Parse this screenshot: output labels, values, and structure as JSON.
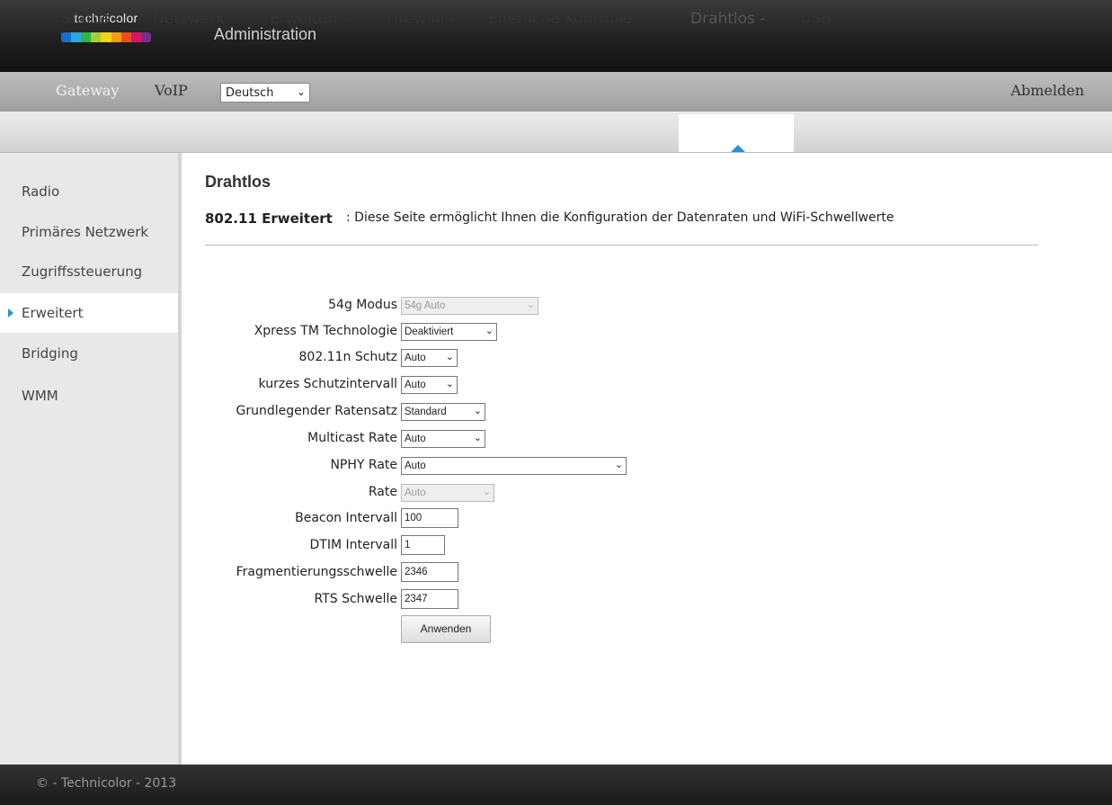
{
  "header": {
    "logo_text": "technicolor",
    "title": "Administration",
    "logo_colors": [
      "#1a6fc9",
      "#2aa7e1",
      "#32b34a",
      "#a6ce39",
      "#f7d117",
      "#f39c12",
      "#e94e1b",
      "#d6186b",
      "#7b2d8e"
    ]
  },
  "subnav": {
    "gateway": "Gateway",
    "voip": "VoIP",
    "language": "Deutsch",
    "logout": "Abmelden"
  },
  "nav": {
    "items": [
      "Status -",
      "Netzwerk -",
      "Erweitert -",
      "Firewall -",
      "Elterliche Kontrolle -",
      "Drahtlos -",
      "USB"
    ],
    "active_index": 5,
    "accent": "#2a8fd9"
  },
  "sidebar": {
    "items": [
      "Radio",
      "Primäres Netzwerk",
      "Zugriffssteuerung",
      "Erweitert",
      "Bridging",
      "WMM"
    ],
    "active_index": 3
  },
  "main": {
    "title": "Drahtlos",
    "desc_label": "802.11 Erweitert",
    "desc_text": ":  Diese Seite ermöglicht Ihnen die Konfiguration der Datenraten und WiFi-Schwellwerte",
    "fields": [
      {
        "label": "54g Modus",
        "value": "54g Auto",
        "kind": "select",
        "disabled": true
      },
      {
        "label": "Xpress TM Technologie",
        "value": "Deaktiviert",
        "kind": "select",
        "disabled": false
      },
      {
        "label": "802.11n Schutz",
        "value": "Auto",
        "kind": "select",
        "disabled": false
      },
      {
        "label": "kurzes Schutzintervall",
        "value": "Auto",
        "kind": "select",
        "disabled": false
      },
      {
        "label": "Grundlegender Ratensatz",
        "value": "Standard",
        "kind": "select",
        "disabled": false
      },
      {
        "label": "Multicast Rate",
        "value": "Auto",
        "kind": "select",
        "disabled": false
      },
      {
        "label": "NPHY Rate",
        "value": "Auto",
        "kind": "select",
        "disabled": false
      },
      {
        "label": "Rate",
        "value": "Auto",
        "kind": "select",
        "disabled": true
      },
      {
        "label": "Beacon Intervall",
        "value": "100",
        "kind": "input"
      },
      {
        "label": "DTIM Intervall",
        "value": "1",
        "kind": "input"
      },
      {
        "label": "Fragmentierungsschwelle",
        "value": "2346",
        "kind": "input"
      },
      {
        "label": "RTS Schwelle",
        "value": "2347",
        "kind": "input"
      }
    ],
    "apply_label": "Anwenden"
  },
  "footer": {
    "text": "© - Technicolor - 2013"
  }
}
